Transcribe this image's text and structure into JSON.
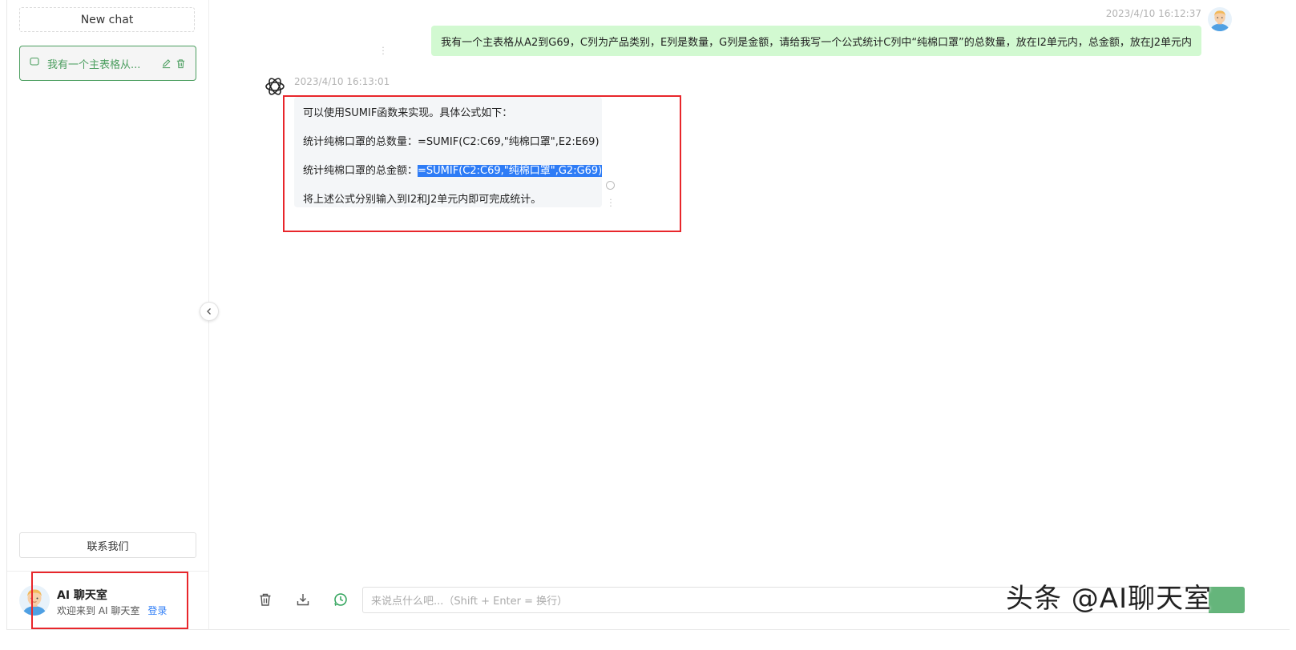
{
  "sidebar": {
    "new_chat_label": "New chat",
    "history": [
      {
        "title": "我有一个主表格从..."
      }
    ],
    "contact_label": "联系我们",
    "user": {
      "name": "AI 聊天室",
      "welcome": "欢迎来到 AI 聊天室",
      "login": "登录"
    }
  },
  "chat": {
    "messages": [
      {
        "role": "user",
        "time": "2023/4/10 16:12:37",
        "text": "我有一个主表格从A2到G69，C列为产品类别，E列是数量，G列是金额，请给我写一个公式统计C列中“纯棉口罩”的总数量，放在I2单元内，总金额，放在J2单元内"
      },
      {
        "role": "assistant",
        "time": "2023/4/10 16:13:01",
        "lines": [
          {
            "text": "可以使用SUMIF函数来实现。具体公式如下："
          },
          {
            "text": "统计纯棉口罩的总数量：=SUMIF(C2:C69,\"纯棉口罩\",E2:E69)"
          },
          {
            "prefix": "统计纯棉口罩的总金额：",
            "highlight": "=SUMIF(C2:C69,\"纯棉口罩\",G2:G69)"
          },
          {
            "text": "将上述公式分别输入到I2和J2单元内即可完成统计。"
          }
        ]
      }
    ]
  },
  "input": {
    "placeholder": "来说点什么吧...（Shift + Enter = 换行）"
  },
  "watermark": "头条 @AI聊天室",
  "colors": {
    "accent": "#4b9e5f",
    "user_bubble": "#d2f9d1",
    "bot_bubble": "#f4f6f8",
    "annotation": "#e8262b",
    "selection": "#2e7cf6"
  }
}
